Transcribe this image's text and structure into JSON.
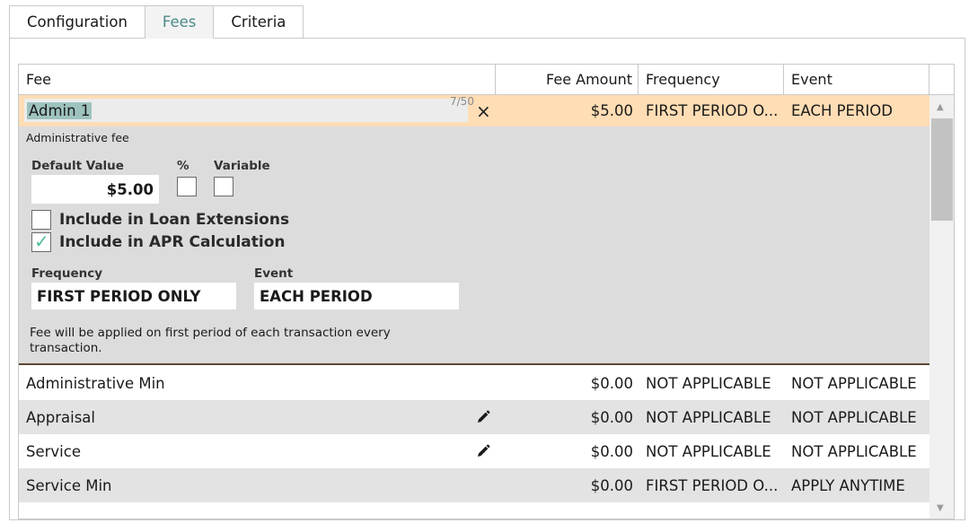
{
  "tabs": [
    {
      "label": "Configuration",
      "active": false
    },
    {
      "label": "Fees",
      "active": true
    },
    {
      "label": "Criteria",
      "active": false
    }
  ],
  "grid": {
    "headers": {
      "fee": "Fee",
      "amount": "Fee Amount",
      "frequency": "Frequency",
      "event": "Event"
    },
    "selected_row": {
      "fee_value": "Admin 1",
      "char_counter": "7/50",
      "amount": "$5.00",
      "frequency": "FIRST PERIOD O...",
      "event": "EACH PERIOD",
      "clear_glyph": "×"
    },
    "detail": {
      "description": "Administrative fee",
      "default_value_label": "Default Value",
      "default_value": "$5.00",
      "percent_label": "%",
      "variable_label": "Variable",
      "include_loan_ext_label": "Include in Loan Extensions",
      "include_loan_ext_checked": false,
      "include_apr_label": "Include in APR Calculation",
      "include_apr_checked": true,
      "frequency_label": "Frequency",
      "frequency_value": "FIRST PERIOD ONLY",
      "event_label": "Event",
      "event_value": "EACH PERIOD",
      "note": "Fee will be applied on first period of each transaction every transaction."
    },
    "rows": [
      {
        "fee": "Administrative Min",
        "amount": "$0.00",
        "frequency": "NOT APPLICABLE",
        "event": "NOT APPLICABLE",
        "editable": false
      },
      {
        "fee": "Appraisal",
        "amount": "$0.00",
        "frequency": "NOT APPLICABLE",
        "event": "NOT APPLICABLE",
        "editable": true
      },
      {
        "fee": "Service",
        "amount": "$0.00",
        "frequency": "NOT APPLICABLE",
        "event": "NOT APPLICABLE",
        "editable": true
      },
      {
        "fee": "Service Min",
        "amount": "$0.00",
        "frequency": "FIRST PERIOD O...",
        "event": "APPLY ANYTIME",
        "editable": false
      },
      {
        "fee": "",
        "amount": "",
        "frequency": "",
        "event": "",
        "editable": false
      }
    ]
  },
  "colors": {
    "accent": "#4a8a86",
    "selected_row": "#ffddb5",
    "check": "#4dbd9a"
  },
  "icons": {
    "edit": "pencil-icon",
    "clear": "close-icon"
  }
}
